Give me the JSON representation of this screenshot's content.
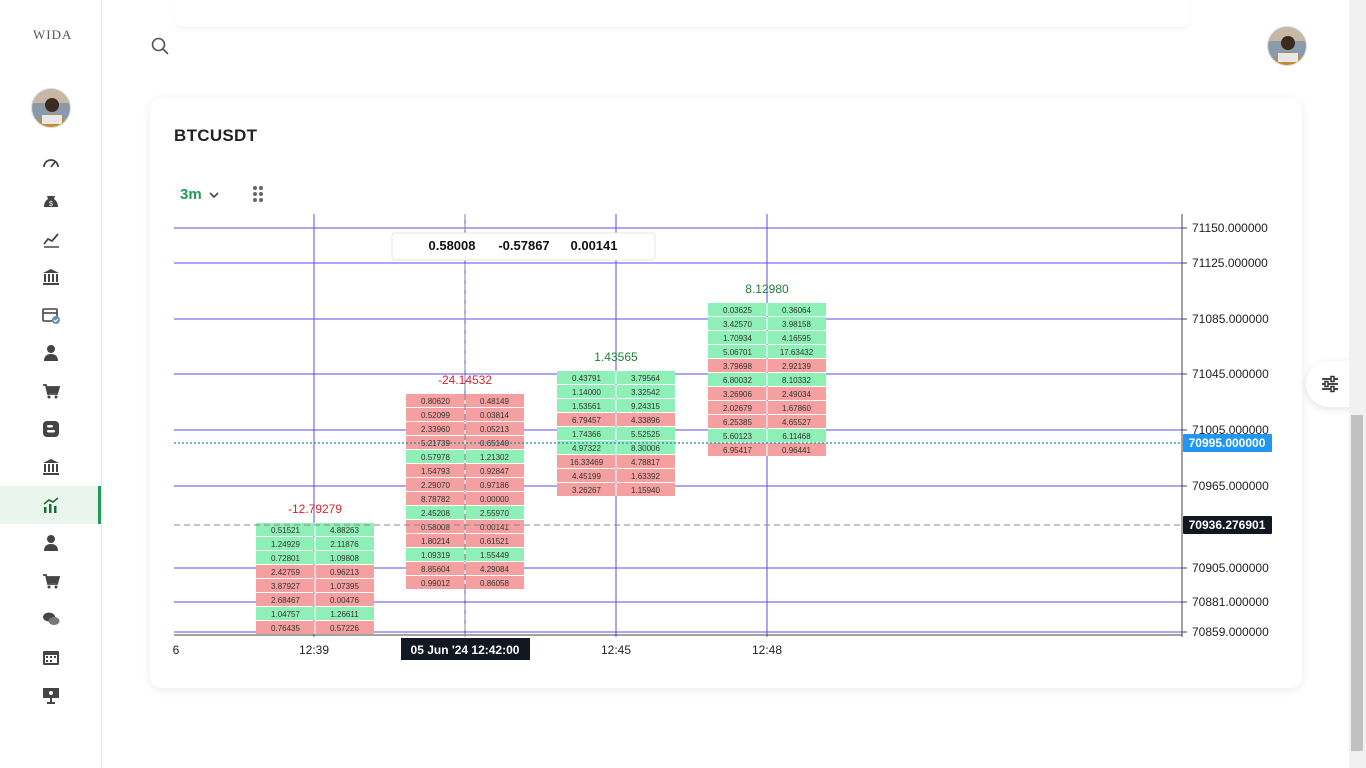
{
  "app": {
    "logo_text": "WIDA"
  },
  "sidebar": {
    "items": [
      {
        "icon": "dashboard-icon"
      },
      {
        "icon": "dollar-bag-icon"
      },
      {
        "icon": "chart-line-icon"
      },
      {
        "icon": "bank-icon"
      },
      {
        "icon": "calendar-check-icon"
      },
      {
        "icon": "user-icon"
      },
      {
        "icon": "cart-icon"
      },
      {
        "icon": "blogger-icon"
      },
      {
        "icon": "bank-icon"
      },
      {
        "icon": "chart-bar-line-icon",
        "active": true
      },
      {
        "icon": "user-icon"
      },
      {
        "icon": "cart-icon"
      },
      {
        "icon": "chat-icon"
      },
      {
        "icon": "calendar-icon"
      },
      {
        "icon": "presentation-icon"
      }
    ]
  },
  "card": {
    "title": "BTCUSDT",
    "timeframe": "3m"
  },
  "chart_data": {
    "type": "footprint",
    "y_ticks": [
      "71150.000000",
      "71125.000000",
      "71085.000000",
      "71045.000000",
      "71005.000000",
      "70965.000000",
      "70905.000000",
      "70881.000000",
      "70859.000000"
    ],
    "x_ticks": [
      "6",
      "12:39",
      "12:45",
      "12:48"
    ],
    "crosshair_time": "05 Jun '24   12:42:00",
    "price_badges": [
      {
        "value": "70995.000000",
        "color": "#2196f3"
      },
      {
        "value": "70936.276901",
        "color": "#131722"
      }
    ],
    "tooltip": [
      "0.58008",
      "-0.57867",
      "0.00141"
    ],
    "colors": {
      "buy": "#8ff0b7",
      "sell": "#f5a0a0",
      "positive": "#1a7f37",
      "negative": "#e0202a",
      "grid": "#5a4fe0"
    },
    "candles": [
      {
        "time": "12:39",
        "delta": "-12.79279",
        "rows": [
          [
            "0.51521",
            "4.88263",
            "buy"
          ],
          [
            "1.24929",
            "2.11876",
            "buy"
          ],
          [
            "0.72801",
            "1.09808",
            "buy"
          ],
          [
            "2.42759",
            "0.96213",
            "sell"
          ],
          [
            "3.87927",
            "1.07395",
            "sell"
          ],
          [
            "2.68467",
            "0.00476",
            "sell"
          ],
          [
            "1.04757",
            "1.26611",
            "buy"
          ],
          [
            "0.76435",
            "0.57226",
            "sell"
          ]
        ]
      },
      {
        "time": "12:42",
        "delta": "-24.14532",
        "rows": [
          [
            "0.80620",
            "0.48149",
            "sell"
          ],
          [
            "0.52099",
            "0.03814",
            "sell"
          ],
          [
            "2.33960",
            "0.05213",
            "sell"
          ],
          [
            "5.21739",
            "0.65140",
            "sell"
          ],
          [
            "0.57978",
            "1.21302",
            "buy"
          ],
          [
            "1.54793",
            "0.92847",
            "sell"
          ],
          [
            "2.29070",
            "0.97186",
            "sell"
          ],
          [
            "8.78782",
            "0.00000",
            "sell"
          ],
          [
            "2.45208",
            "2.55970",
            "buy"
          ],
          [
            "0.58008",
            "0.00141",
            "sell"
          ],
          [
            "1.80214",
            "0.61521",
            "sell"
          ],
          [
            "1.09319",
            "1.55449",
            "buy"
          ],
          [
            "8.85604",
            "4.29084",
            "sell"
          ],
          [
            "0.99012",
            "0.86058",
            "sell"
          ]
        ]
      },
      {
        "time": "12:45",
        "delta": "1.43565",
        "rows": [
          [
            "0.43791",
            "3.79564",
            "buy"
          ],
          [
            "1.14000",
            "3.32542",
            "buy"
          ],
          [
            "1.53561",
            "9.24315",
            "buy"
          ],
          [
            "6.79457",
            "4.33896",
            "sell"
          ],
          [
            "1.74366",
            "5.52525",
            "buy"
          ],
          [
            "4.97322",
            "8.30006",
            "buy"
          ],
          [
            "16.33469",
            "4.78817",
            "sell"
          ],
          [
            "4.45199",
            "1.63392",
            "sell"
          ],
          [
            "3.26267",
            "1.15940",
            "sell"
          ]
        ]
      },
      {
        "time": "12:48",
        "delta": "8.12980",
        "rows": [
          [
            "0.03625",
            "0.36064",
            "buy"
          ],
          [
            "3.42570",
            "3.98158",
            "buy"
          ],
          [
            "1.70934",
            "4.16595",
            "buy"
          ],
          [
            "5.06701",
            "17.63432",
            "buy"
          ],
          [
            "3.79698",
            "2.92139",
            "sell"
          ],
          [
            "6.80032",
            "8.10332",
            "buy"
          ],
          [
            "3.26906",
            "2.49034",
            "sell"
          ],
          [
            "2.02679",
            "1.67860",
            "sell"
          ],
          [
            "6.25385",
            "4.65527",
            "sell"
          ],
          [
            "5.60123",
            "6.11468",
            "buy"
          ],
          [
            "6.95417",
            "0.96441",
            "sell"
          ]
        ]
      }
    ]
  }
}
